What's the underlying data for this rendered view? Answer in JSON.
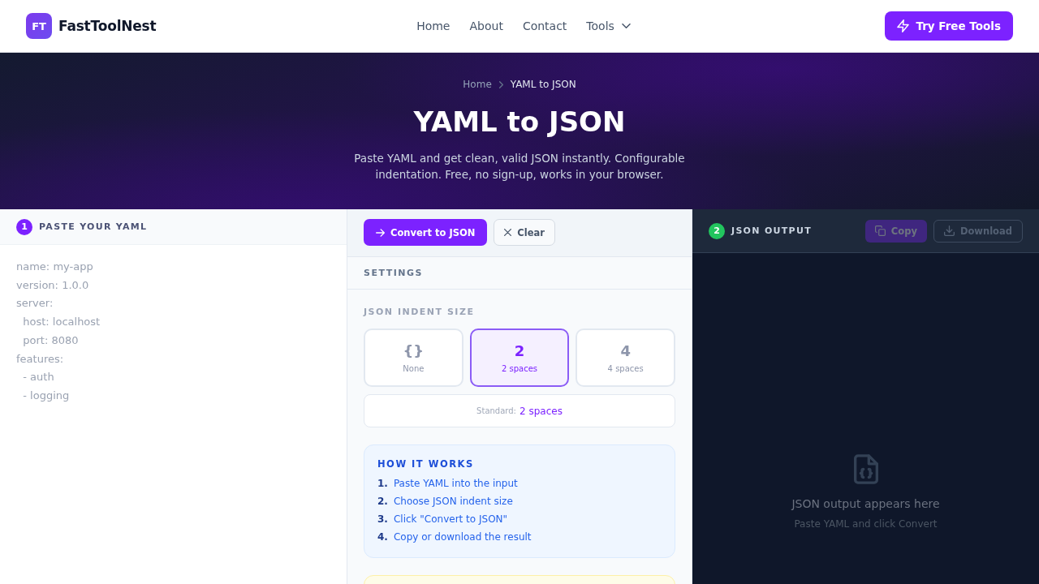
{
  "header": {
    "logo_mark": "FT",
    "brand": "FastToolNest",
    "nav": [
      {
        "label": "Home",
        "kind": "link"
      },
      {
        "label": "About",
        "kind": "link"
      },
      {
        "label": "Contact",
        "kind": "link"
      },
      {
        "label": "Tools",
        "kind": "menu"
      }
    ],
    "cta": "Try Free Tools"
  },
  "hero": {
    "breadcrumb": [
      {
        "label": "Home",
        "current": false
      },
      {
        "label": "YAML to JSON",
        "current": true
      }
    ],
    "title": "YAML to JSON",
    "subtitle": "Paste YAML and get clean, valid JSON instantly. Configurable indentation. Free, no sign-up, works in your browser."
  },
  "input_panel": {
    "step": "1",
    "title": "PASTE YOUR YAML",
    "placeholder": "name: my-app\nversion: 1.0.0\nserver:\n  host: localhost\n  port: 8080\nfeatures:\n  - auth\n  - logging"
  },
  "controls": {
    "actions": [
      {
        "label": "Convert to JSON",
        "kind": "primary"
      },
      {
        "label": "Clear",
        "kind": "secondary"
      }
    ],
    "settings_title": "SETTINGS",
    "indent_label": "JSON INDENT SIZE",
    "indent_options": [
      {
        "glyph": "{}",
        "label": "None",
        "selected": false
      },
      {
        "glyph": "2",
        "label": "2 spaces",
        "selected": true
      },
      {
        "glyph": "4",
        "label": "4 spaces",
        "selected": false
      }
    ],
    "standard": {
      "label": "Standard:",
      "value": "2 spaces"
    },
    "how_it_works": {
      "title": "HOW IT WORKS",
      "steps": [
        {
          "number": "1.",
          "text": "Paste YAML into the input"
        },
        {
          "number": "2.",
          "text": "Choose JSON indent size"
        },
        {
          "number": "3.",
          "text": "Click \"Convert to JSON\""
        },
        {
          "number": "4.",
          "text": "Copy or download the result"
        }
      ]
    }
  },
  "output_panel": {
    "step": "2",
    "title": "JSON OUTPUT",
    "actions": [
      {
        "label": "Copy",
        "kind": "copy",
        "disabled": true
      },
      {
        "label": "Download",
        "kind": "download",
        "disabled": true
      }
    ],
    "empty_title": "JSON output appears here",
    "empty_hint": "Paste YAML and click Convert"
  }
}
